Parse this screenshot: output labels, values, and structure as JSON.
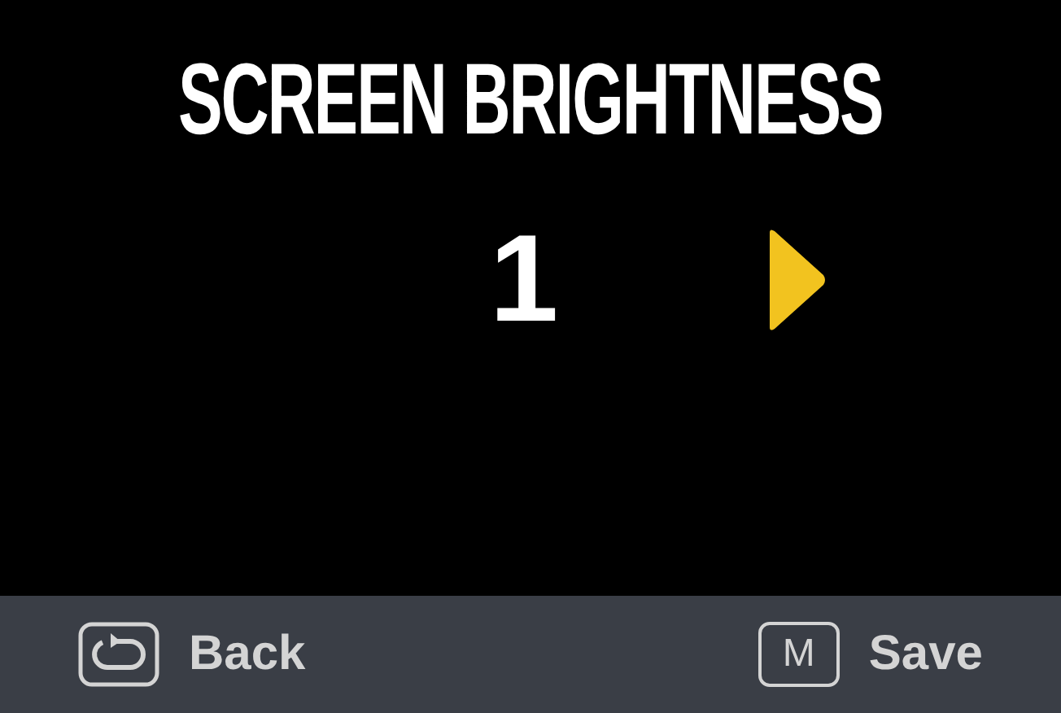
{
  "title": "SCREEN BRIGHTNESS",
  "value": "1",
  "actions": [
    {
      "kind": "back",
      "label": "Back"
    },
    {
      "kind": "key",
      "key": "M",
      "label": "Save"
    }
  ]
}
